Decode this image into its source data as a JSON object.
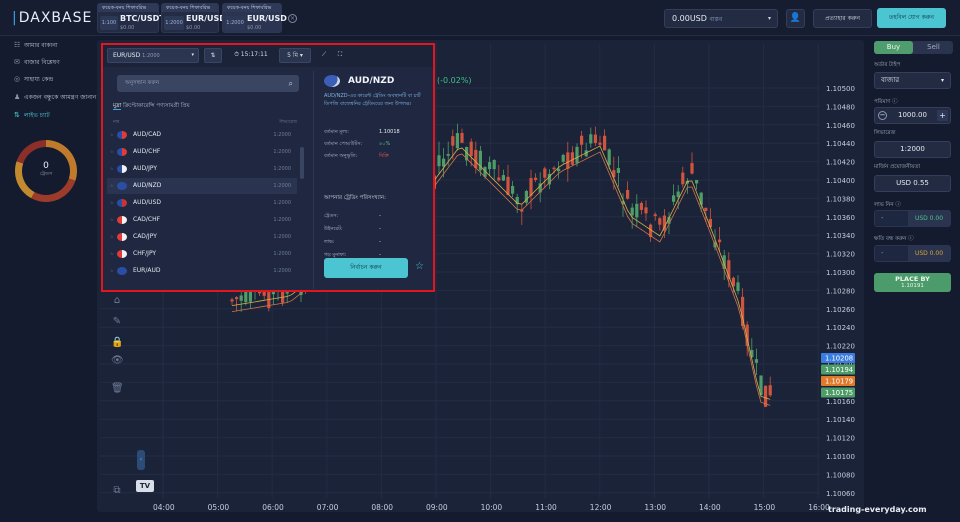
{
  "logo": {
    "mark": "|",
    "text": "DAXBASE"
  },
  "tabs": [
    {
      "header": "কয়েক-বনয় শিফাবরিভ",
      "leverage": "1:100",
      "symbol": "BTC/USDT",
      "amount": "$0.00"
    },
    {
      "header": "কয়েক-বনয় শিফাবরিভ",
      "leverage": "1:2000",
      "symbol": "EUR/USD",
      "amount": "$0.00"
    },
    {
      "header": "কয়েক-বনয় শিফাবরিভ",
      "leverage": "1:2000",
      "symbol": "EUR/USD",
      "amount": "$0.00"
    }
  ],
  "tab_close": "×",
  "account": {
    "balance": "0.00USD",
    "currency": "বাস্তব",
    "caret": "▾"
  },
  "header_buttons": {
    "user": "👤",
    "withdraw": "প্রত্যাহার করুন",
    "deposit": "তহবিল যোগ করুন"
  },
  "nav": [
    {
      "icon": "☷",
      "label": "আমার বাকানা",
      "active": false
    },
    {
      "icon": "✉",
      "label": "বাজার বিশ্লেষণ",
      "active": false
    },
    {
      "icon": "◎",
      "label": "সাহায্য কেন্দ্র",
      "active": false
    },
    {
      "icon": "♟",
      "label": "একজন বন্ধুকে আমন্ত্রণ জানান",
      "active": false
    },
    {
      "icon": "⇅",
      "label": "লাইভ চ্যাট",
      "active": true
    }
  ],
  "gauge": {
    "value": "0",
    "label": "ট্রেডস"
  },
  "chart": {
    "change": "(-0.02%)",
    "price_axis": [
      "1.10500",
      "1.10480",
      "1.10460",
      "1.10440",
      "1.10420",
      "1.10400",
      "1.10380",
      "1.10360",
      "1.10340",
      "1.10320",
      "1.10300",
      "1.10280",
      "1.10260",
      "1.10240",
      "1.10220",
      "1.10200",
      "1.10180",
      "1.10160",
      "1.10140",
      "1.10120",
      "1.10100",
      "1.10080",
      "1.10060"
    ],
    "time_axis": [
      "04:00",
      "05:00",
      "06:00",
      "07:00",
      "08:00",
      "09:00",
      "10:00",
      "11:00",
      "12:00",
      "13:00",
      "14:00",
      "15:00",
      "16:00"
    ],
    "price_tags": [
      {
        "value": "1.10208",
        "color": "#3a7ce0"
      },
      {
        "value": "1.10194",
        "color": "#4e9d68"
      },
      {
        "value": "1.10179",
        "color": "#e07a2a"
      },
      {
        "value": "1.10175",
        "color": "#4e9d68"
      }
    ],
    "tv": "TV",
    "nub": "‹"
  },
  "tools": [
    "⌂",
    "✎",
    "🔒",
    "👁",
    "🗑",
    "⧉"
  ],
  "trade": {
    "buy": "Buy",
    "sell": "Sell",
    "order_type_label": "অর্ডার টাইপ",
    "order_type": "বাজার",
    "qty_label": "পরিমাণ ⓘ",
    "qty": "1000.00",
    "leverage_label": "লিভারেজ",
    "leverage": "1:2000",
    "margin_label": "মার্জিন প্রয়োজনীয়তা",
    "margin": "USD 0.55",
    "tp_label": "লাভ নিন ⓘ",
    "tp_value": "USD 0.00",
    "sl_label": "ক্ষতি বন্ধ করুন ⓘ",
    "sl_value": "USD 0.00",
    "dash": "-",
    "place_title": "PLACE BY",
    "place_price": "1.10191"
  },
  "popup": {
    "pair": "EUR/USD",
    "pair_lev": "1:2000",
    "time": "⏱ 15:17:11",
    "tf": "5 মি ▾",
    "search_placeholder": "অনুসন্ধান করুন",
    "categories": [
      "মুদ্রা",
      "ক্রিপ্টোকারেন্সি",
      "পণ্যসামগ্রী",
      "প্রিয়"
    ],
    "col_left": "নাম",
    "col_right": "লিভারেজ",
    "list": [
      {
        "symbol": "AUD/CAD",
        "leverage": "1:2000",
        "colors": [
          "#2a4ea6",
          "#e03a3a"
        ]
      },
      {
        "symbol": "AUD/CHF",
        "leverage": "1:2000",
        "colors": [
          "#2a4ea6",
          "#e03a3a"
        ]
      },
      {
        "symbol": "AUD/JPY",
        "leverage": "1:2000",
        "colors": [
          "#2a4ea6",
          "#f2f2f2"
        ]
      },
      {
        "symbol": "AUD/NZD",
        "leverage": "1:2000",
        "colors": [
          "#2a4ea6",
          "#2a4ea6"
        ]
      },
      {
        "symbol": "AUD/USD",
        "leverage": "1:2000",
        "colors": [
          "#2a4ea6",
          "#c33"
        ]
      },
      {
        "symbol": "CAD/CHF",
        "leverage": "1:2000",
        "colors": [
          "#e03a3a",
          "#f2f2f2"
        ]
      },
      {
        "symbol": "CAD/JPY",
        "leverage": "1:2000",
        "colors": [
          "#e03a3a",
          "#f2f2f2"
        ]
      },
      {
        "symbol": "CHF/JPY",
        "leverage": "1:2000",
        "colors": [
          "#e03a3a",
          "#f2f2f2"
        ]
      },
      {
        "symbol": "EUR/AUD",
        "leverage": "1:2000",
        "colors": [
          "#2a4ea6",
          "#2a4ea6"
        ]
      }
    ],
    "detail": {
      "title": "AUD/NZD",
      "desc": "AUD/NZD-এর কারেন্ট ট্রেডিং অবস্থানটি বা চার্ট ডিপজি বাজেশ্বনির ট্রেডিংয়ের জন্য উপলব্ধ।",
      "rows": [
        {
          "k": "বর্তমান মূল্য:",
          "v": "1.10018",
          "cls": ""
        },
        {
          "k": "বর্তমান পেআউটস:",
          "v": "৪০%",
          "cls": "g"
        },
        {
          "k": "বর্তমান অনুভূতি:",
          "v": "বিক্রি",
          "cls": "r"
        }
      ],
      "sub": "আপনার ট্রেডিং পরিসংখ্যান:",
      "stats": [
        {
          "k": "ট্রেডস:",
          "v": "-"
        },
        {
          "k": "উইনরেট:",
          "v": "-"
        },
        {
          "k": "লাভ:",
          "v": "-"
        },
        {
          "k": "গড় মুনাফা:",
          "v": "-"
        }
      ],
      "button": "নির্বাচন করুন",
      "fav": "☆"
    }
  }
}
